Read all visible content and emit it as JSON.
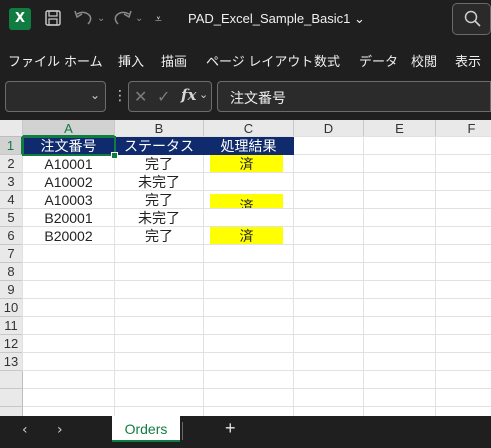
{
  "titlebar": {
    "logo": "X",
    "document_title": "PAD_Excel_Sample_Basic1",
    "title_chevron": "⌄",
    "save_icon": "save-icon",
    "undo_icon": "undo-icon",
    "redo_icon": "redo-icon",
    "search_icon": "search-icon"
  },
  "ribbon": {
    "tabs": [
      "ファイル",
      "ホーム",
      "挿入",
      "描画",
      "ページ レイアウト",
      "数式",
      "データ",
      "校閲",
      "表示"
    ]
  },
  "formula_bar": {
    "name_box_value": "",
    "cancel_glyph": "✕",
    "enter_glyph": "✓",
    "fx_label": "fx",
    "formula_value": "注文番号"
  },
  "grid": {
    "columns": [
      "A",
      "B",
      "C",
      "D",
      "E",
      "F"
    ],
    "rows": [
      "1",
      "2",
      "3",
      "4",
      "5",
      "6",
      "7",
      "8",
      "9",
      "10",
      "11",
      "12",
      "13"
    ],
    "header_row": [
      "注文番号",
      "ステータス",
      "処理結果"
    ],
    "data_rows": [
      [
        "A10001",
        "完了",
        "済"
      ],
      [
        "A10002",
        "未完了",
        ""
      ],
      [
        "A10003",
        "完了",
        "済"
      ],
      [
        "B20001",
        "未完了",
        ""
      ],
      [
        "B20002",
        "完了",
        "済"
      ]
    ],
    "selected_cell": "A1",
    "colors": {
      "header_fill": "#0f2b6e",
      "highlight_fill": "#ffff00",
      "selection": "#107c41"
    }
  },
  "sheet_tabs": {
    "active": "Orders",
    "add_label": "+",
    "prev_icon": "chevron-left-icon",
    "next_icon": "chevron-right-icon"
  }
}
